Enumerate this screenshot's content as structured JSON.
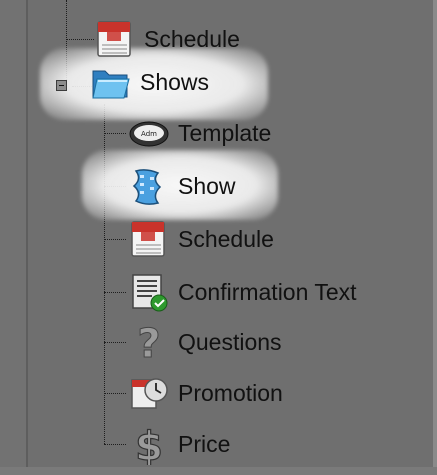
{
  "tree": {
    "parent_items": [
      {
        "label": "Schedule",
        "icon": "calendar-icon"
      },
      {
        "label": "Shows",
        "icon": "folder-open-icon",
        "expanded": true
      }
    ],
    "children": [
      {
        "label": "Template",
        "icon": "ticket-icon"
      },
      {
        "label": "Show",
        "icon": "film-icon"
      },
      {
        "label": "Schedule",
        "icon": "calendar-icon"
      },
      {
        "label": "Confirmation Text",
        "icon": "document-check-icon"
      },
      {
        "label": "Questions",
        "icon": "question-mark-icon"
      },
      {
        "label": "Promotion",
        "icon": "clock-calendar-icon"
      },
      {
        "label": "Price",
        "icon": "dollar-icon"
      }
    ],
    "highlighted": [
      "Shows",
      "Show"
    ]
  }
}
